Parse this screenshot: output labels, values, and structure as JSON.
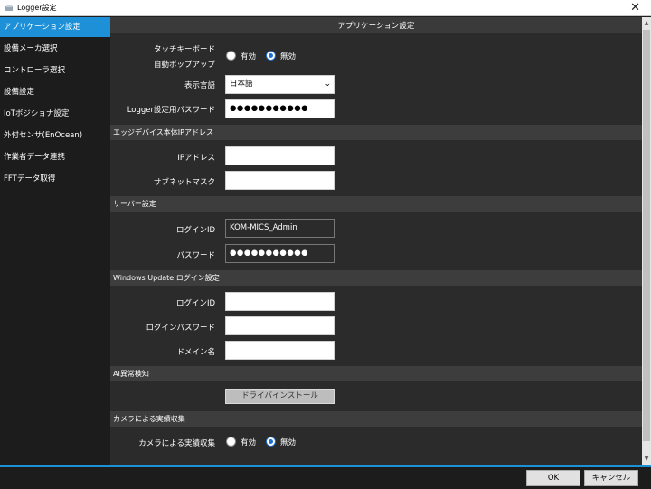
{
  "window": {
    "title": "Logger設定",
    "close_glyph": "✕"
  },
  "sidebar": {
    "items": [
      {
        "label": "アプリケーション設定",
        "active": true
      },
      {
        "label": "設備メーカ選択"
      },
      {
        "label": "コントローラ選択"
      },
      {
        "label": "設備設定"
      },
      {
        "label": "IoTボジショナ設定"
      },
      {
        "label": "外付センサ(EnOcean)"
      },
      {
        "label": "作業者データ連携"
      },
      {
        "label": "FFTデータ取得"
      }
    ]
  },
  "header": {
    "title": "アプリケーション設定"
  },
  "app": {
    "touch_keyboard_label_1": "タッチキーボード",
    "touch_keyboard_label_2": "自動ポップアップ",
    "touch_on": "有効",
    "touch_off": "無効",
    "touch_value": "無効",
    "language_label": "表示言語",
    "language_value": "日本語",
    "logger_pw_label": "Logger設定用パスワード",
    "logger_pw_value": "●●●●●●●●●●●"
  },
  "edge": {
    "section": "エッジデバイス本体IPアドレス",
    "ip_label": "IPアドレス",
    "ip_value": "",
    "subnet_label": "サブネットマスク",
    "subnet_value": ""
  },
  "server": {
    "section": "サーバー設定",
    "login_label": "ログインID",
    "login_value": "KOM-MICS_Admin",
    "pw_label": "パスワード",
    "pw_value": "●●●●●●●●●●●"
  },
  "wu": {
    "section": "Windows Update ログイン設定",
    "login_label": "ログインID",
    "login_value": "",
    "pw_label": "ログインパスワード",
    "pw_value": "",
    "domain_label": "ドメイン名",
    "domain_value": ""
  },
  "ai": {
    "section": "AI異常検知",
    "install_button": "ドライバインストール"
  },
  "camera": {
    "section": "カメラによる実績収集",
    "label": "カメラによる実績収集",
    "on": "有効",
    "off": "無効",
    "value": "無効"
  },
  "footer": {
    "ok": "OK",
    "cancel": "キャンセル"
  },
  "colors": {
    "accent": "#1e90d8",
    "radio_selected": "#1e6fcc"
  }
}
